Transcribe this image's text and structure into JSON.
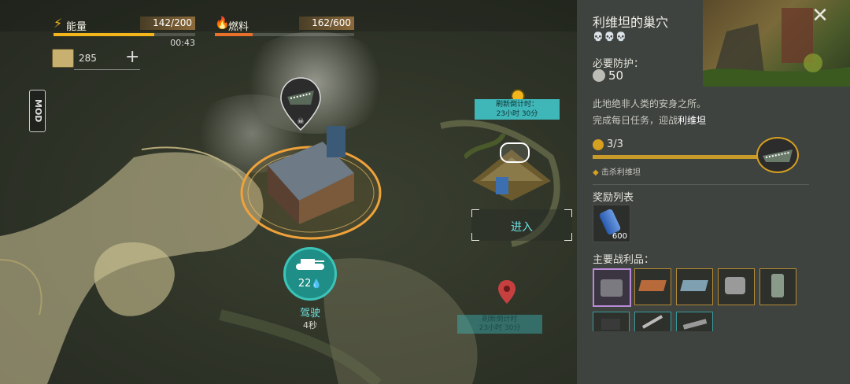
{
  "hud": {
    "energy": {
      "label": "能量",
      "value": "142/200",
      "fraction": 0.71,
      "timer": "00:43",
      "color": "#f2b51c"
    },
    "fuel": {
      "label": "燃料",
      "value": "162/600",
      "fraction": 0.27,
      "color": "#e8702a"
    },
    "resource_count": "285",
    "add_symbol": "+",
    "mod_label": "MOD"
  },
  "map": {
    "refresh_label_top": "刷新倒计时：",
    "refresh_time_top": "23小时 30分",
    "enter_label": "进入",
    "vehicle_fuel": "22",
    "drive_label": "驾驶",
    "drive_time": "4秒",
    "refresh_label_bottom": "刷新倒计时",
    "refresh_time_bottom": "23小时 30分"
  },
  "panel": {
    "title": "利维坦的巢穴",
    "close_symbol": "✕",
    "skull_icons": "💀💀💀",
    "defense_label": "必要防护：",
    "defense_value": "50",
    "desc_line1": "此地绝非人类的安身之所。",
    "desc_line2_prefix": "完成每日任务，迎战",
    "desc_line2_name": "利维坦",
    "progress": "3/3",
    "progress_fraction": 1.0,
    "task": "击杀利维坦",
    "reward_title": "奖励列表",
    "reward_qty": "600",
    "loot_title": "主要战利品："
  }
}
